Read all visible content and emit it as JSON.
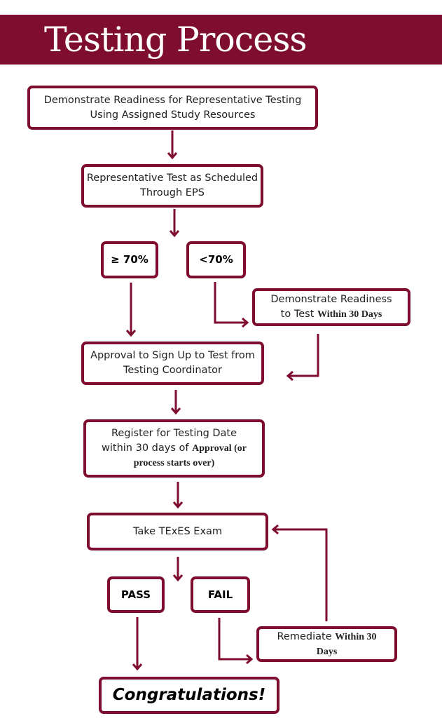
{
  "header": {
    "title": "Testing Process"
  },
  "colors": {
    "accent": "#7f0d2f",
    "background": "#ffffff"
  },
  "steps": {
    "readiness": {
      "line1": "Demonstrate Readiness for Representative Testing",
      "line2": "Using Assigned Study Resources"
    },
    "rep_test": {
      "line1": "Representative Test as Scheduled",
      "line2": "Through EPS"
    },
    "pass_rep": {
      "label": "≥ 70%"
    },
    "fail_rep": {
      "label": "<70%"
    },
    "retry_readiness": {
      "line1": "Demonstrate Readiness",
      "line2_a": "to Test ",
      "line2_b": "Within 30 Days"
    },
    "approval": {
      "line1": "Approval to Sign Up to Test from",
      "line2": "Testing Coordinator"
    },
    "register": {
      "line1": "Register for Testing Date",
      "line2_a": "within 30 days of ",
      "line2_b": "Approval (or",
      "line3": "process starts over)"
    },
    "exam": {
      "label": "Take TExES Exam"
    },
    "pass": {
      "label": "PASS"
    },
    "fail": {
      "label": "FAIL"
    },
    "remediate": {
      "line1_a": "Remediate ",
      "line1_b": "Within 30",
      "line2": "Days"
    },
    "congrats": {
      "label": "Congratulations!"
    }
  }
}
